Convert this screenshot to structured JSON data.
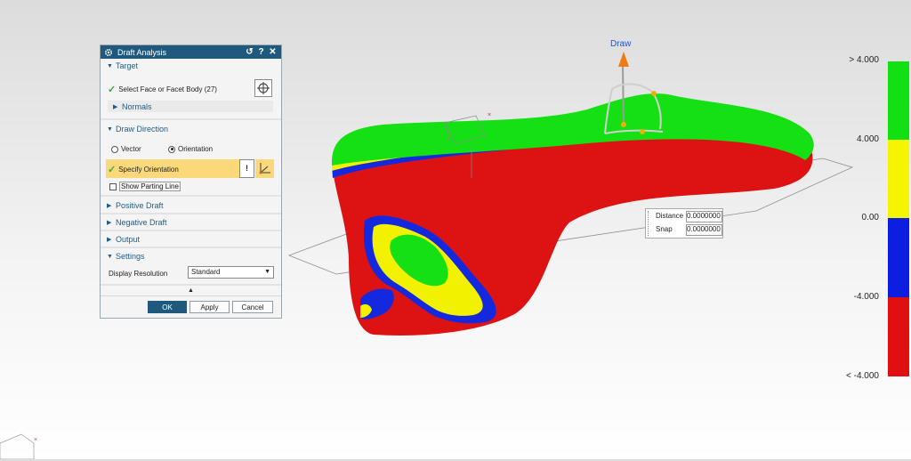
{
  "dialog": {
    "title": "Draft Analysis",
    "title_buttons": {
      "reset": "↺",
      "help": "?",
      "close": "✕"
    },
    "target": {
      "header": "Target",
      "select_label": "Select Face or Facet Body (27)",
      "normals_label": "Normals"
    },
    "draw_direction": {
      "header": "Draw Direction",
      "vector_label": "Vector",
      "orientation_label": "Orientation",
      "selected_mode": "Orientation",
      "specify_orientation_label": "Specify Orientation",
      "show_parting_line_label": "Show Parting Line",
      "show_parting_line_checked": false
    },
    "positive_draft_header": "Positive Draft",
    "negative_draft_header": "Negative Draft",
    "output_header": "Output",
    "settings": {
      "header": "Settings",
      "display_resolution_label": "Display Resolution",
      "display_resolution_value": "Standard"
    },
    "buttons": {
      "ok": "OK",
      "apply": "Apply",
      "cancel": "Cancel"
    }
  },
  "viewport": {
    "draw_label": "Draw",
    "distance_label": "Distance",
    "distance_value": "0.0000000",
    "snap_label": "Snap",
    "snap_value": "0.0000000"
  },
  "legend": {
    "labels": [
      "> 4.000",
      "4.000",
      "0.00",
      "-4.000",
      "< -4.000"
    ],
    "colors": [
      "#12e012",
      "#f5f500",
      "#0c1ee0",
      "#e01010"
    ]
  }
}
